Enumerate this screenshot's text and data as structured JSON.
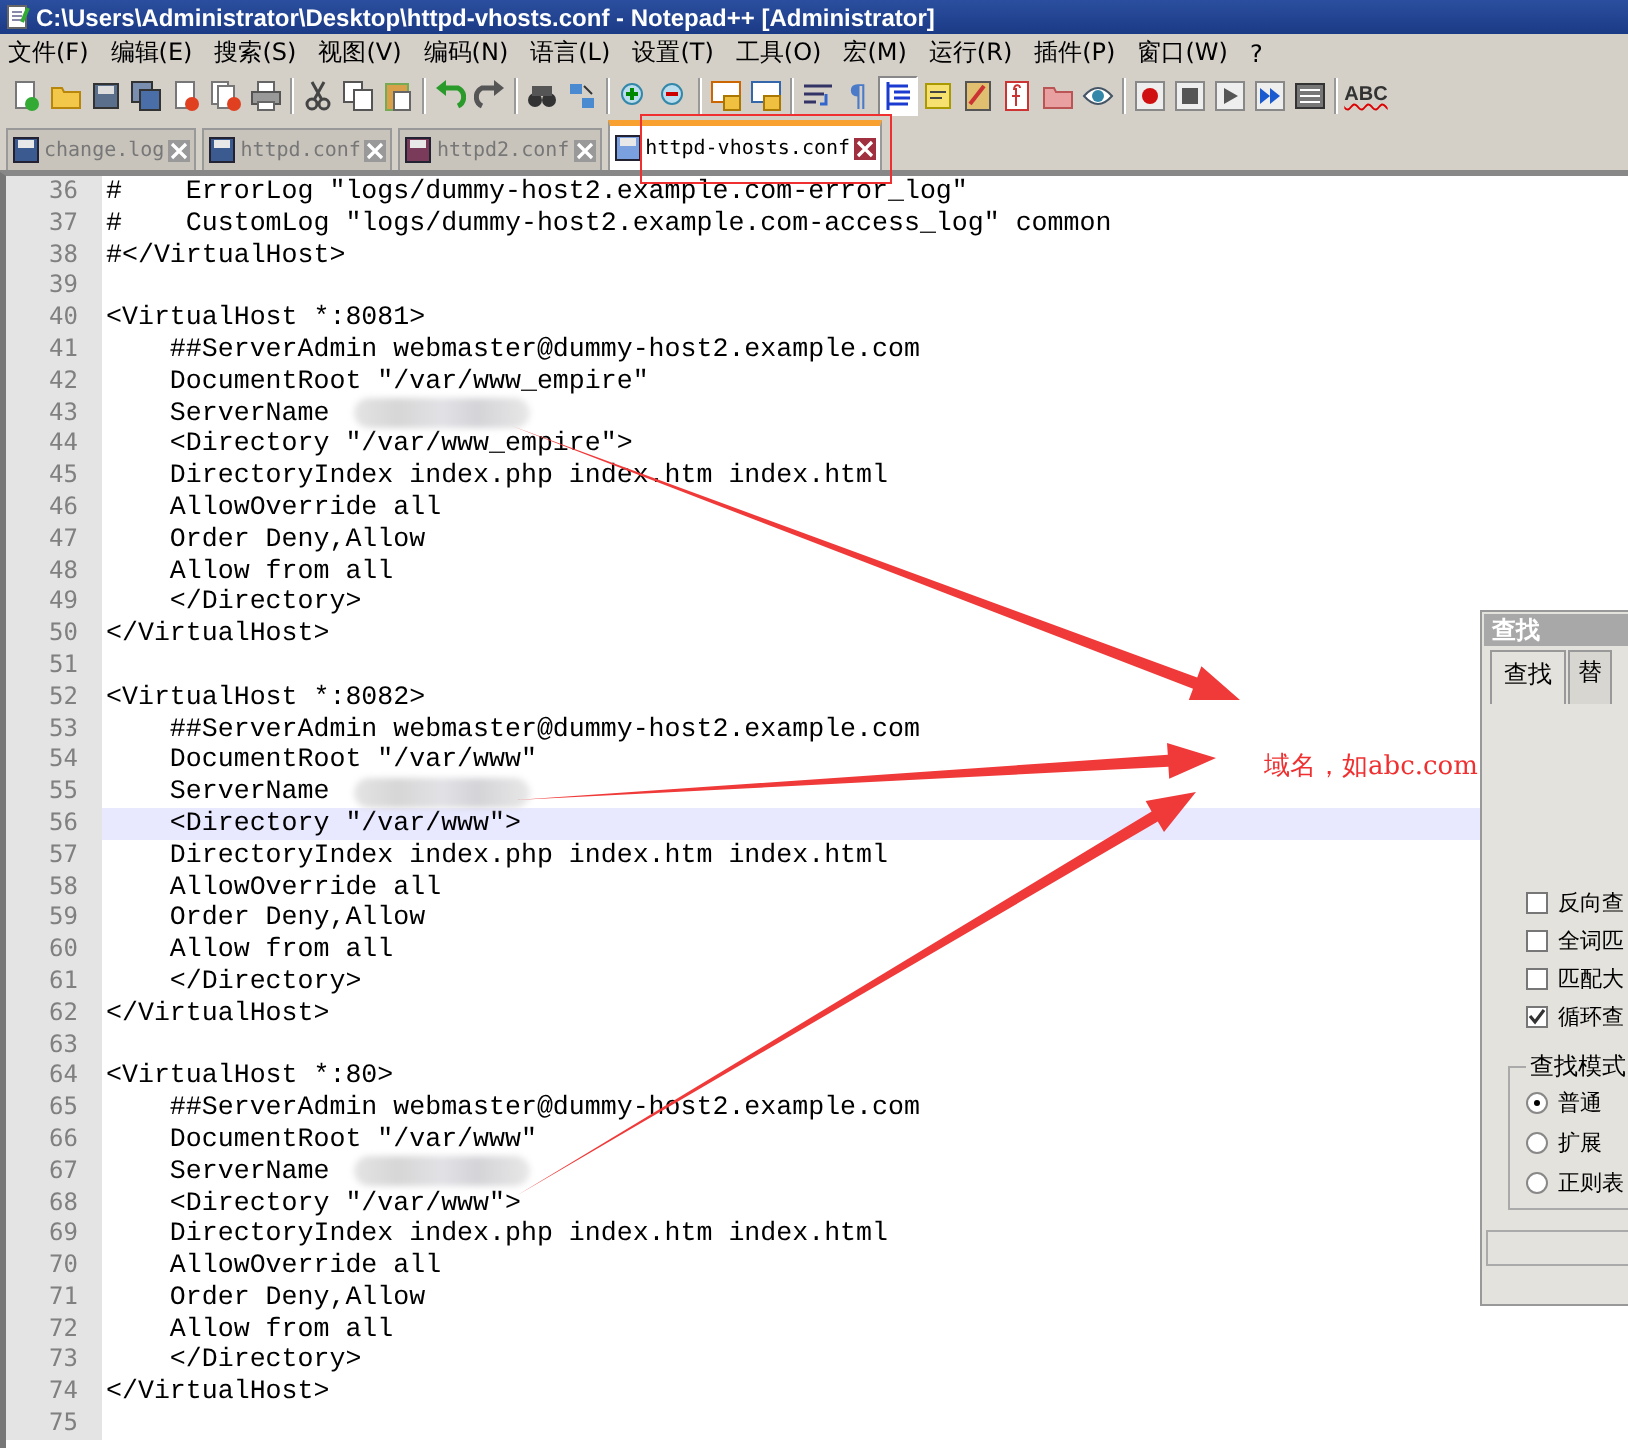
{
  "window": {
    "title": "C:\\Users\\Administrator\\Desktop\\httpd-vhosts.conf - Notepad++ [Administrator]"
  },
  "menu": [
    "文件(F)",
    "编辑(E)",
    "搜索(S)",
    "视图(V)",
    "编码(N)",
    "语言(L)",
    "设置(T)",
    "工具(O)",
    "宏(M)",
    "运行(R)",
    "插件(P)",
    "窗口(W)",
    "?"
  ],
  "toolbar": [
    [
      {
        "kind": "new"
      },
      {
        "kind": "open"
      },
      {
        "kind": "save"
      },
      {
        "kind": "save-all"
      },
      {
        "kind": "close"
      },
      {
        "kind": "close-all"
      },
      {
        "kind": "print"
      }
    ],
    [
      {
        "kind": "cut"
      },
      {
        "kind": "copy"
      },
      {
        "kind": "paste"
      }
    ],
    [
      {
        "kind": "undo"
      },
      {
        "kind": "redo"
      }
    ],
    [
      {
        "kind": "find"
      },
      {
        "kind": "replace"
      }
    ],
    [
      {
        "kind": "zoom-in"
      },
      {
        "kind": "zoom-out"
      }
    ],
    [
      {
        "kind": "sync-v"
      },
      {
        "kind": "sync-h"
      }
    ],
    [
      {
        "kind": "wrap"
      },
      {
        "kind": "glyph",
        "label": "¶"
      },
      {
        "kind": "indent",
        "pressed": true
      },
      {
        "kind": "note"
      },
      {
        "kind": "map"
      },
      {
        "kind": "function"
      },
      {
        "kind": "folder"
      },
      {
        "kind": "eye"
      }
    ],
    [
      {
        "kind": "record"
      },
      {
        "kind": "stop"
      },
      {
        "kind": "play"
      },
      {
        "kind": "play-multi"
      },
      {
        "kind": "save-macro"
      }
    ],
    [
      {
        "kind": "spell",
        "label": "ABC"
      }
    ]
  ],
  "tabs": [
    {
      "label": "change.log",
      "selected": false,
      "unsaved": false
    },
    {
      "label": "httpd.conf",
      "selected": false,
      "unsaved": false
    },
    {
      "label": "httpd2.conf",
      "selected": false,
      "unsaved": true
    },
    {
      "label": "httpd-vhosts.conf",
      "selected": true,
      "unsaved": false
    }
  ],
  "editor": {
    "lines": [
      {
        "number": "36",
        "text": "#    ErrorLog \"logs/dummy-host2.example.com-error_log\""
      },
      {
        "number": "37",
        "text": "#    CustomLog \"logs/dummy-host2.example.com-access_log\" common"
      },
      {
        "number": "38",
        "text": "#</VirtualHost>"
      },
      {
        "number": "39"
      },
      {
        "number": "40",
        "text": "<VirtualHost *:8081>"
      },
      {
        "number": "41",
        "text": "    ##ServerAdmin webmaster@dummy-host2.example.com"
      },
      {
        "number": "42",
        "text": "    DocumentRoot \"/var/www_empire\""
      },
      {
        "number": "43",
        "text": "    ServerName",
        "redacted": true
      },
      {
        "number": "44",
        "text": "    <Directory \"/var/www_empire\">"
      },
      {
        "number": "45",
        "text": "    DirectoryIndex index.php index.htm index.html"
      },
      {
        "number": "46",
        "text": "    AllowOverride all"
      },
      {
        "number": "47",
        "text": "    Order Deny,Allow"
      },
      {
        "number": "48",
        "text": "    Allow from all"
      },
      {
        "number": "49",
        "text": "    </Directory>"
      },
      {
        "number": "50",
        "text": "</VirtualHost>"
      },
      {
        "number": "51"
      },
      {
        "number": "52",
        "text": "<VirtualHost *:8082>"
      },
      {
        "number": "53",
        "text": "    ##ServerAdmin webmaster@dummy-host2.example.com"
      },
      {
        "number": "54",
        "text": "    DocumentRoot \"/var/www\""
      },
      {
        "number": "55",
        "text": "    ServerName",
        "redacted": true
      },
      {
        "number": "56",
        "text": "    <Directory \"/var/www\">",
        "current": true
      },
      {
        "number": "57",
        "text": "    DirectoryIndex index.php index.htm index.html"
      },
      {
        "number": "58",
        "text": "    AllowOverride all"
      },
      {
        "number": "59",
        "text": "    Order Deny,Allow"
      },
      {
        "number": "60",
        "text": "    Allow from all"
      },
      {
        "number": "61",
        "text": "    </Directory>"
      },
      {
        "number": "62",
        "text": "</VirtualHost>"
      },
      {
        "number": "63"
      },
      {
        "number": "64",
        "text": "<VirtualHost *:80>"
      },
      {
        "number": "65",
        "text": "    ##ServerAdmin webmaster@dummy-host2.example.com"
      },
      {
        "number": "66",
        "text": "    DocumentRoot \"/var/www\""
      },
      {
        "number": "67",
        "text": "    ServerName",
        "redacted": true
      },
      {
        "number": "68",
        "text": "    <Directory \"/var/www\">"
      },
      {
        "number": "69",
        "text": "    DirectoryIndex index.php index.htm index.html"
      },
      {
        "number": "70",
        "text": "    AllowOverride all"
      },
      {
        "number": "71",
        "text": "    Order Deny,Allow"
      },
      {
        "number": "72",
        "text": "    Allow from all"
      },
      {
        "number": "73",
        "text": "    </Directory>"
      },
      {
        "number": "74",
        "text": "</VirtualHost>"
      },
      {
        "number": "75"
      }
    ]
  },
  "find_dialog": {
    "title": "查找",
    "tabs": [
      {
        "label": "查找",
        "selected": true
      },
      {
        "label": "替",
        "selected": false
      }
    ],
    "options": [
      {
        "label": "反向查",
        "checked": false
      },
      {
        "label": "全词匹",
        "checked": false
      },
      {
        "label": "匹配大",
        "checked": false
      },
      {
        "label": "循环查",
        "checked": true
      }
    ],
    "search_mode": {
      "title": "查找模式",
      "options": [
        {
          "label": "普通",
          "selected": true
        },
        {
          "label": "扩展",
          "selected": false
        },
        {
          "label": "正则表",
          "selected": false
        }
      ]
    }
  },
  "annotation": {
    "label": "域名，如abc.com"
  }
}
